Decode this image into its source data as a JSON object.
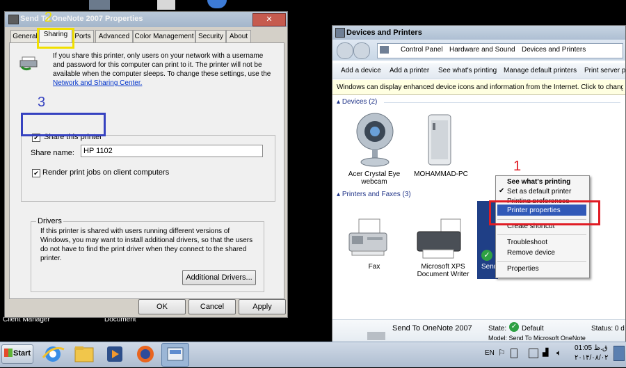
{
  "desktop": {
    "labels": [
      "Client Manager",
      "Document"
    ]
  },
  "props_dialog": {
    "title": "Send To OneNote 2007 Properties",
    "close_glyph": "✕",
    "tabs": [
      "General",
      "Sharing",
      "Ports",
      "Advanced",
      "Color Management",
      "Security",
      "About"
    ],
    "active_tab": "Sharing",
    "intro_text": "If you share this printer, only users on your network with a username and password for this computer can print to it. The printer will not be available when the computer sleeps. To change these settings, use the",
    "intro_link": "Network and Sharing Center.",
    "share_checkbox_label": "Share this printer",
    "share_checked": true,
    "share_name_label": "Share name:",
    "share_name_value": "HP 1102",
    "render_label": "Render print jobs on client computers",
    "render_checked": true,
    "drivers_title": "Drivers",
    "drivers_text": "If this printer is shared with users running different versions of Windows, you may want to install additional drivers, so that the users do not have to find the print driver when they connect to the shared printer.",
    "additional_drivers_button": "Additional Drivers...",
    "ok_button": "OK",
    "cancel_button": "Cancel",
    "apply_button": "Apply"
  },
  "annotations": {
    "step1": "1",
    "step2": "2",
    "step3": "3"
  },
  "devices_window": {
    "title": "Devices and Printers",
    "breadcrumb": [
      "Control Panel",
      "Hardware and Sound",
      "Devices and Printers"
    ],
    "toolbar": [
      "Add a device",
      "Add a printer",
      "See what's printing",
      "Manage default printers",
      "Print server pr"
    ],
    "info_bar": "Windows can display enhanced device icons and information from the Internet. Click to change...",
    "devices_header": "Devices (2)",
    "devices": [
      "Acer Crystal Eye webcam",
      "MOHAMMAD-PC"
    ],
    "printers_header": "Printers and Faxes (3)",
    "printers": [
      "Fax",
      "Microsoft XPS Document Writer",
      "Send"
    ],
    "details": {
      "name": "Send To OneNote 2007",
      "state_label": "State:",
      "state_value": "Default",
      "status_label": "Status: 0 d",
      "model_partial": "Model: Send To Microsoft OneNote"
    }
  },
  "context_menu": {
    "items": [
      "See what's printing",
      "Set as default printer",
      "Printing preferences",
      "Printer properties",
      "Create shortcut",
      "Troubleshoot",
      "Remove device",
      "Properties"
    ],
    "highlighted": "Printer properties",
    "checked": "Set as default printer"
  },
  "taskbar": {
    "start_label": "Start",
    "lang": "EN",
    "time": "01:05 ق.ظ",
    "date": "۲۰۱۴/۰۸/۰۲"
  },
  "colors": {
    "highlight": "#3159b8",
    "annotation_red": "#e01c24",
    "annotation_blue": "#3642c0",
    "annotation_yellow": "#f1e000"
  }
}
